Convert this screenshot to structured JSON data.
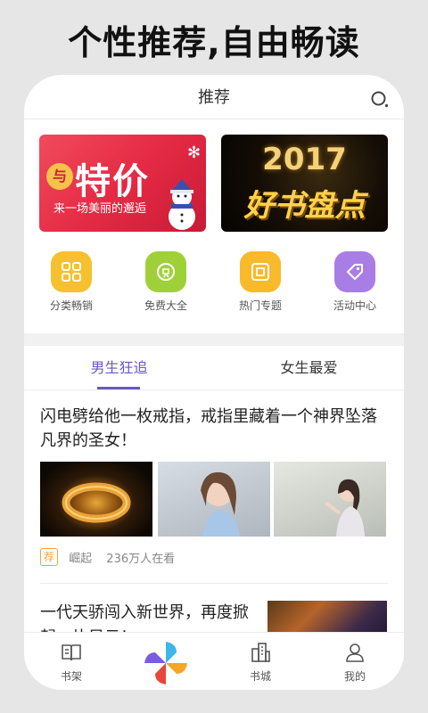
{
  "headline": "个性推荐,自由畅读",
  "topbar": {
    "title": "推荐",
    "search_icon": "search-icon"
  },
  "banners": [
    {
      "badge": "与",
      "big": "特价",
      "sub": "来一场美丽的邂逅"
    },
    {
      "year": "2017",
      "title": "好书盘点"
    }
  ],
  "categories": [
    {
      "label": "分类畅销",
      "icon": "grid-icon",
      "color": "#f6c02f"
    },
    {
      "label": "免费大全",
      "icon": "free-icon",
      "color": "#9fd03a"
    },
    {
      "label": "热门专题",
      "icon": "topic-icon",
      "color": "#f8b92b"
    },
    {
      "label": "活动中心",
      "icon": "tag-icon",
      "color": "#a97de6"
    }
  ],
  "tabs": [
    {
      "label": "男生狂追",
      "active": true
    },
    {
      "label": "女生最爱",
      "active": false
    }
  ],
  "articles": [
    {
      "title": "闪电劈给他一枚戒指，戒指里藏着一个神界坠落凡界的圣女！",
      "tag": "荐",
      "source": "崛起",
      "readers": "236万人在看"
    },
    {
      "title": "一代天骄闯入新世界，再度掀起一片风云！"
    }
  ],
  "bottom_nav": [
    {
      "label": "书架",
      "icon": "bookshelf-icon"
    },
    {
      "label": "",
      "icon": "pinwheel-logo-icon"
    },
    {
      "label": "书城",
      "icon": "bookstore-icon"
    },
    {
      "label": "我的",
      "icon": "profile-icon"
    }
  ],
  "accent_color": "#6a57c8"
}
